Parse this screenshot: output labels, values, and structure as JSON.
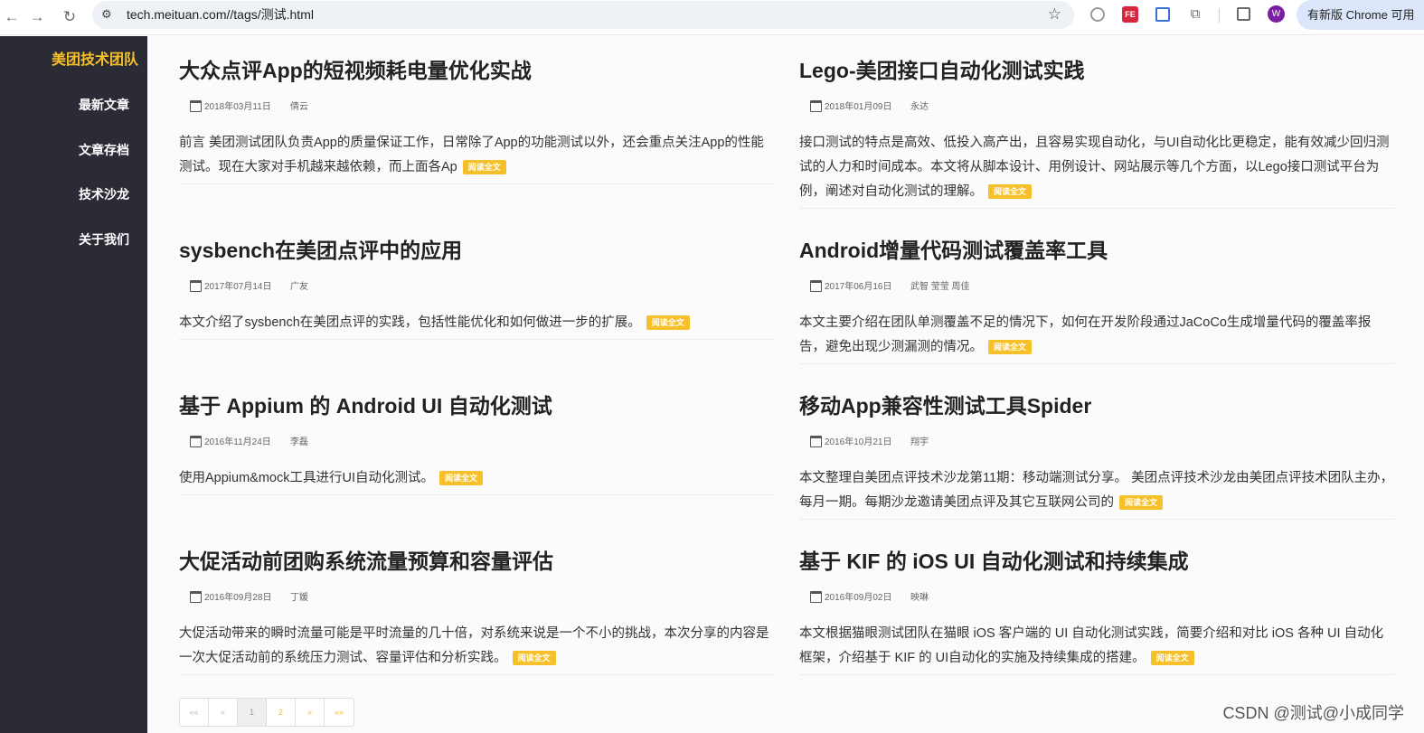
{
  "browser": {
    "url": "tech.meituan.com//tags/测试.html",
    "update_label": "有新版 Chrome 可用",
    "profile_initial": "W",
    "ext_fe_label": "FE"
  },
  "sidebar": {
    "brand": "美团技术团队",
    "items": [
      {
        "label": "最新文章"
      },
      {
        "label": "文章存档"
      },
      {
        "label": "技术沙龙"
      },
      {
        "label": "关于我们"
      }
    ]
  },
  "read_more": "阅读全文",
  "posts": [
    {
      "title": "大众点评App的短视频耗电量优化实战",
      "date": "2018年03月11日",
      "author": "倩云",
      "excerpt": "前言 美团测试团队负责App的质量保证工作，日常除了App的功能测试以外，还会重点关注App的性能测试。现在大家对手机越来越依赖，而上面各Ap"
    },
    {
      "title": "Lego-美团接口自动化测试实践",
      "date": "2018年01月09日",
      "author": "永达",
      "excerpt": "接口测试的特点是高效、低投入高产出，且容易实现自动化，与UI自动化比更稳定，能有效减少回归测试的人力和时间成本。本文将从脚本设计、用例设计、网站展示等几个方面，以Lego接口测试平台为例，阐述对自动化测试的理解。"
    },
    {
      "title": "sysbench在美团点评中的应用",
      "date": "2017年07月14日",
      "author": "广友",
      "excerpt": "本文介绍了sysbench在美团点评的实践，包括性能优化和如何做进一步的扩展。"
    },
    {
      "title": "Android增量代码测试覆盖率工具",
      "date": "2017年06月16日",
      "author": "武智 莹莹 周佳",
      "excerpt": "本文主要介绍在团队单测覆盖不足的情况下，如何在开发阶段通过JaCoCo生成增量代码的覆盖率报告，避免出现少测漏测的情况。"
    },
    {
      "title": "基于 Appium 的 Android UI 自动化测试",
      "date": "2016年11月24日",
      "author": "李磊",
      "excerpt": "使用Appium&mock工具进行UI自动化测试。"
    },
    {
      "title": "移动App兼容性测试工具Spider",
      "date": "2016年10月21日",
      "author": "翔宇",
      "excerpt": "本文整理自美团点评技术沙龙第11期：移动端测试分享。 美团点评技术沙龙由美团点评技术团队主办，每月一期。每期沙龙邀请美团点评及其它互联网公司的"
    },
    {
      "title": "大促活动前团购系统流量预算和容量评估",
      "date": "2016年09月28日",
      "author": "丁媛",
      "excerpt": "大促活动带来的瞬时流量可能是平时流量的几十倍，对系统来说是一个不小的挑战，本次分享的内容是一次大促活动前的系统压力测试、容量评估和分析实践。"
    },
    {
      "title": "基于 KIF 的 iOS UI 自动化测试和持续集成",
      "date": "2016年09月02日",
      "author": "映琳",
      "excerpt": "本文根据猫眼测试团队在猫眼 iOS 客户端的 UI 自动化测试实践，简要介绍和对比 iOS 各种 UI 自动化框架，介绍基于 KIF 的 UI自动化的实施及持续集成的搭建。"
    }
  ],
  "pagination": {
    "first": "««",
    "prev": "«",
    "pages": [
      "1",
      "2"
    ],
    "current": "1",
    "next": "»",
    "last": "»»"
  },
  "watermark": "CSDN @测试@小成同学"
}
